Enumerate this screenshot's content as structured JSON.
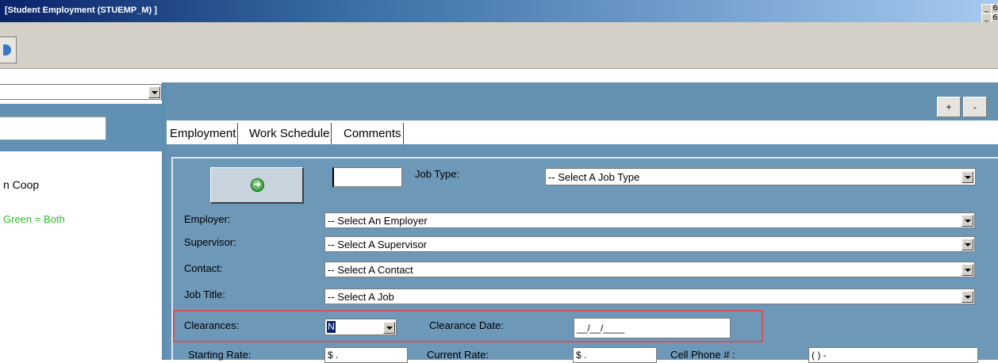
{
  "window": {
    "title": "[Student Employment  (STUEMP_M) ]",
    "min_label": "_",
    "restore_label": "6"
  },
  "left_panel": {
    "dropdown_value": "",
    "search_value": "",
    "program_text": "n Coop",
    "legend_text": "Green = Both"
  },
  "controls": {
    "plus_label": "+",
    "minus_label": "-"
  },
  "tabs": [
    {
      "label": "Employment",
      "active": true
    },
    {
      "label": "Work Schedule",
      "active": false
    },
    {
      "label": "Comments",
      "active": false
    }
  ],
  "form": {
    "go_icon": "arrow-right-circle-icon",
    "id_value": "",
    "job_type_label": "Job Type:",
    "job_type_value": "-- Select A Job Type",
    "employer_label": "Employer:",
    "employer_value": "-- Select An Employer",
    "supervisor_label": "Supervisor:",
    "supervisor_value": "-- Select A Supervisor",
    "contact_label": "Contact:",
    "contact_value": "-- Select A Contact",
    "job_title_label": "Job Title:",
    "job_title_value": "-- Select A Job",
    "clearances_label": "Clearances:",
    "clearances_value": "N",
    "clearance_date_label": "Clearance Date:",
    "clearance_date_value": "__/__/____",
    "starting_rate_label": "Starting Rate:",
    "starting_rate_value": "$  .",
    "current_rate_label": "Current Rate:",
    "current_rate_value": "$  .",
    "cell_phone_label": "Cell Phone # :",
    "cell_phone_value": "(  )  -"
  },
  "colors": {
    "panel_blue": "#6592b3",
    "legend_green": "#22c222",
    "highlight_red": "#d2555a"
  }
}
